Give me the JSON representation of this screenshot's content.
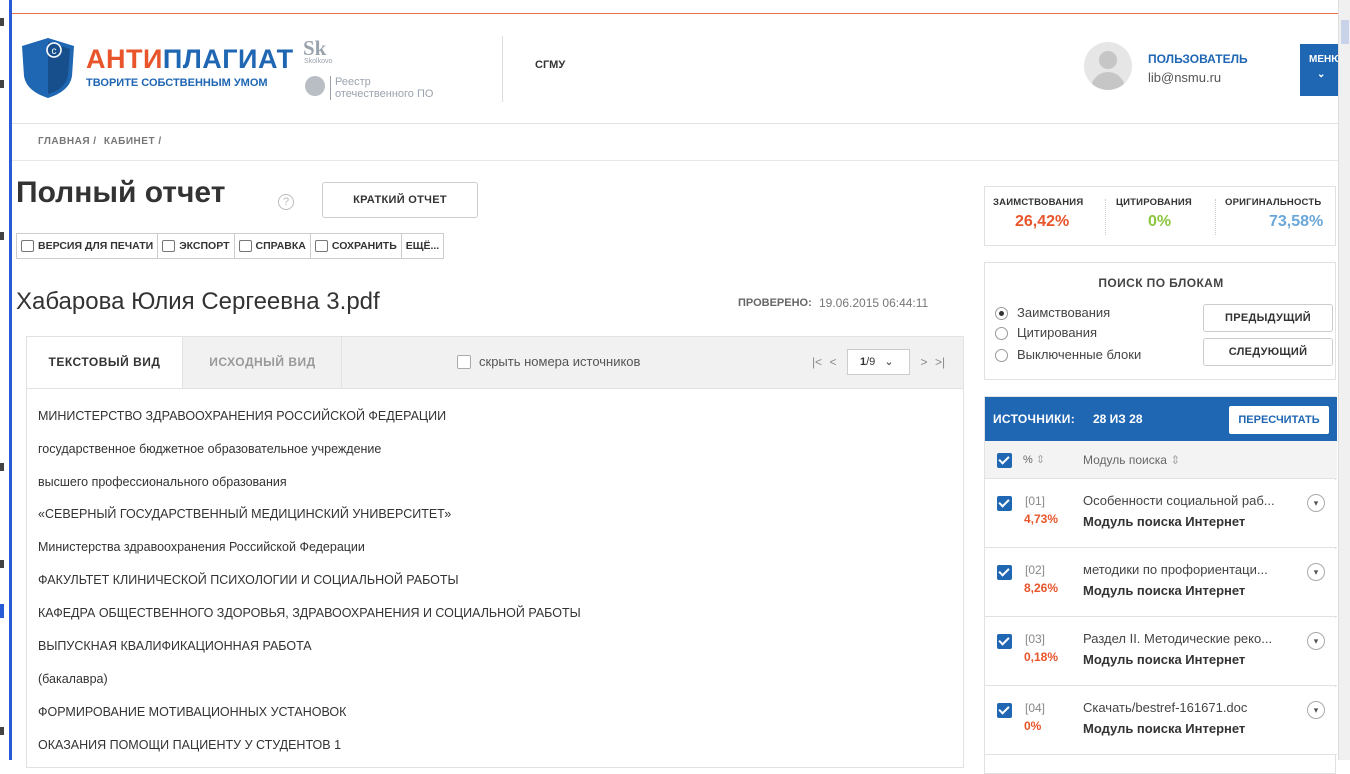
{
  "header": {
    "brand_part1": "АНТИ",
    "brand_part2": "ПЛАГИАТ",
    "tagline": "ТВОРИТЕ СОБСТВЕННЫМ УМОМ",
    "sk_logo": "Sk",
    "sk_sub": "Skolkovo",
    "registry_line1": "Реестр",
    "registry_line2": "отечественного ПО",
    "organization": "СГМУ",
    "user_role": "ПОЛЬЗОВАТЕЛЬ",
    "user_email": "lib@nsmu.ru",
    "menu_label": "МЕНЮ",
    "menu_icon": "chevron-down-icon"
  },
  "breadcrumb": [
    "ГЛАВНАЯ /",
    "КАБИНЕТ /"
  ],
  "report": {
    "title": "Полный отчет",
    "help_icon": "?",
    "short_report_label": "КРАТКИЙ ОТЧЕТ",
    "toolbar": {
      "print": "ВЕРСИЯ ДЛЯ ПЕЧАТИ",
      "export": "ЭКСПОРТ",
      "help": "СПРАВКА",
      "save": "СОХРАНИТЬ",
      "more": "ЕЩЁ..."
    },
    "document_name": "Хабарова Юлия Сергеевна 3.pdf",
    "checked_label": "ПРОВЕРЕНО:",
    "checked_value": "19.06.2015 06:44:11"
  },
  "viewer": {
    "tab_text": "ТЕКСТОВЫЙ ВИД",
    "tab_source": "ИСХОДНЫЙ ВИД",
    "hide_numbers_label": "скрыть номера источников",
    "page_current": "1",
    "page_total": "/9",
    "nav_first": "|<",
    "nav_prev": "<",
    "nav_next": ">",
    "nav_last": ">|",
    "lines": [
      "МИНИСТЕРСТВО ЗДРАВООХРАНЕНИЯ РОССИЙСКОЙ ФЕДЕРАЦИИ",
      "государственное бюджетное образовательное учреждение",
      "высшего профессионального образования",
      "«СЕВЕРНЫЙ ГОСУДАРСТВЕННЫЙ МЕДИЦИНСКИЙ УНИВЕРСИТЕТ»",
      "Министерства здравоохранения Российской Федерации",
      "ФАКУЛЬТЕТ КЛИНИЧЕСКОЙ ПСИХОЛОГИИ И СОЦИАЛЬНОЙ РАБОТЫ",
      "КАФЕДРА ОБЩЕСТВЕННОГО ЗДОРОВЬЯ, ЗДРАВООХРАНЕНИЯ И СОЦИАЛЬНОЙ РАБОТЫ",
      "ВЫПУСКНАЯ КВАЛИФИКАЦИОННАЯ РАБОТА",
      "(бакалавра)",
      "ФОРМИРОВАНИЕ МОТИВАЦИОННЫХ УСТАНОВОК",
      "ОКАЗАНИЯ ПОМОЩИ ПАЦИЕНТУ У СТУДЕНТОВ 1"
    ]
  },
  "stats": {
    "borrowing_label": "ЗАИМСТВОВАНИЯ",
    "borrowing_value": "26,42%",
    "citation_label": "ЦИТИРОВАНИЯ",
    "citation_value": "0%",
    "originality_label": "ОРИГИНАЛЬНОСТЬ",
    "originality_value": "73,58%",
    "colors": {
      "borrowing": "#e8552b",
      "citation": "#8dc63f",
      "originality": "#6aa7d8"
    }
  },
  "block_search": {
    "title": "ПОИСК ПО БЛОКАМ",
    "options": [
      "Заимствования",
      "Цитирования",
      "Выключенные блоки"
    ],
    "selected": "Заимствования",
    "prev_label": "ПРЕДЫДУЩИЙ",
    "next_label": "СЛЕДУЮЩИЙ"
  },
  "sources": {
    "label": "ИСТОЧНИКИ:",
    "count": "28 ИЗ 28",
    "recalc_label": "ПЕРЕСЧИТАТЬ",
    "col_pct": "% ",
    "col_module": "Модуль поиска ",
    "sort_icon": "sort-icon",
    "rows": [
      {
        "num": "[01]",
        "pct": "4,73%",
        "name": "Особенности социальной раб...",
        "module": "Модуль поиска Интернет"
      },
      {
        "num": "[02]",
        "pct": "8,26%",
        "name": "методики по профориентаци...",
        "module": "Модуль поиска Интернет"
      },
      {
        "num": "[03]",
        "pct": "0,18%",
        "name": "Раздел II. Методические реко...",
        "module": "Модуль поиска Интернет"
      },
      {
        "num": "[04]",
        "pct": "0%",
        "name": "Скачать/bestref-161671.doc",
        "module": "Модуль поиска Интернет"
      }
    ]
  },
  "colors": {
    "accent": "#1f66b3",
    "brand_orange": "#e8552b"
  }
}
